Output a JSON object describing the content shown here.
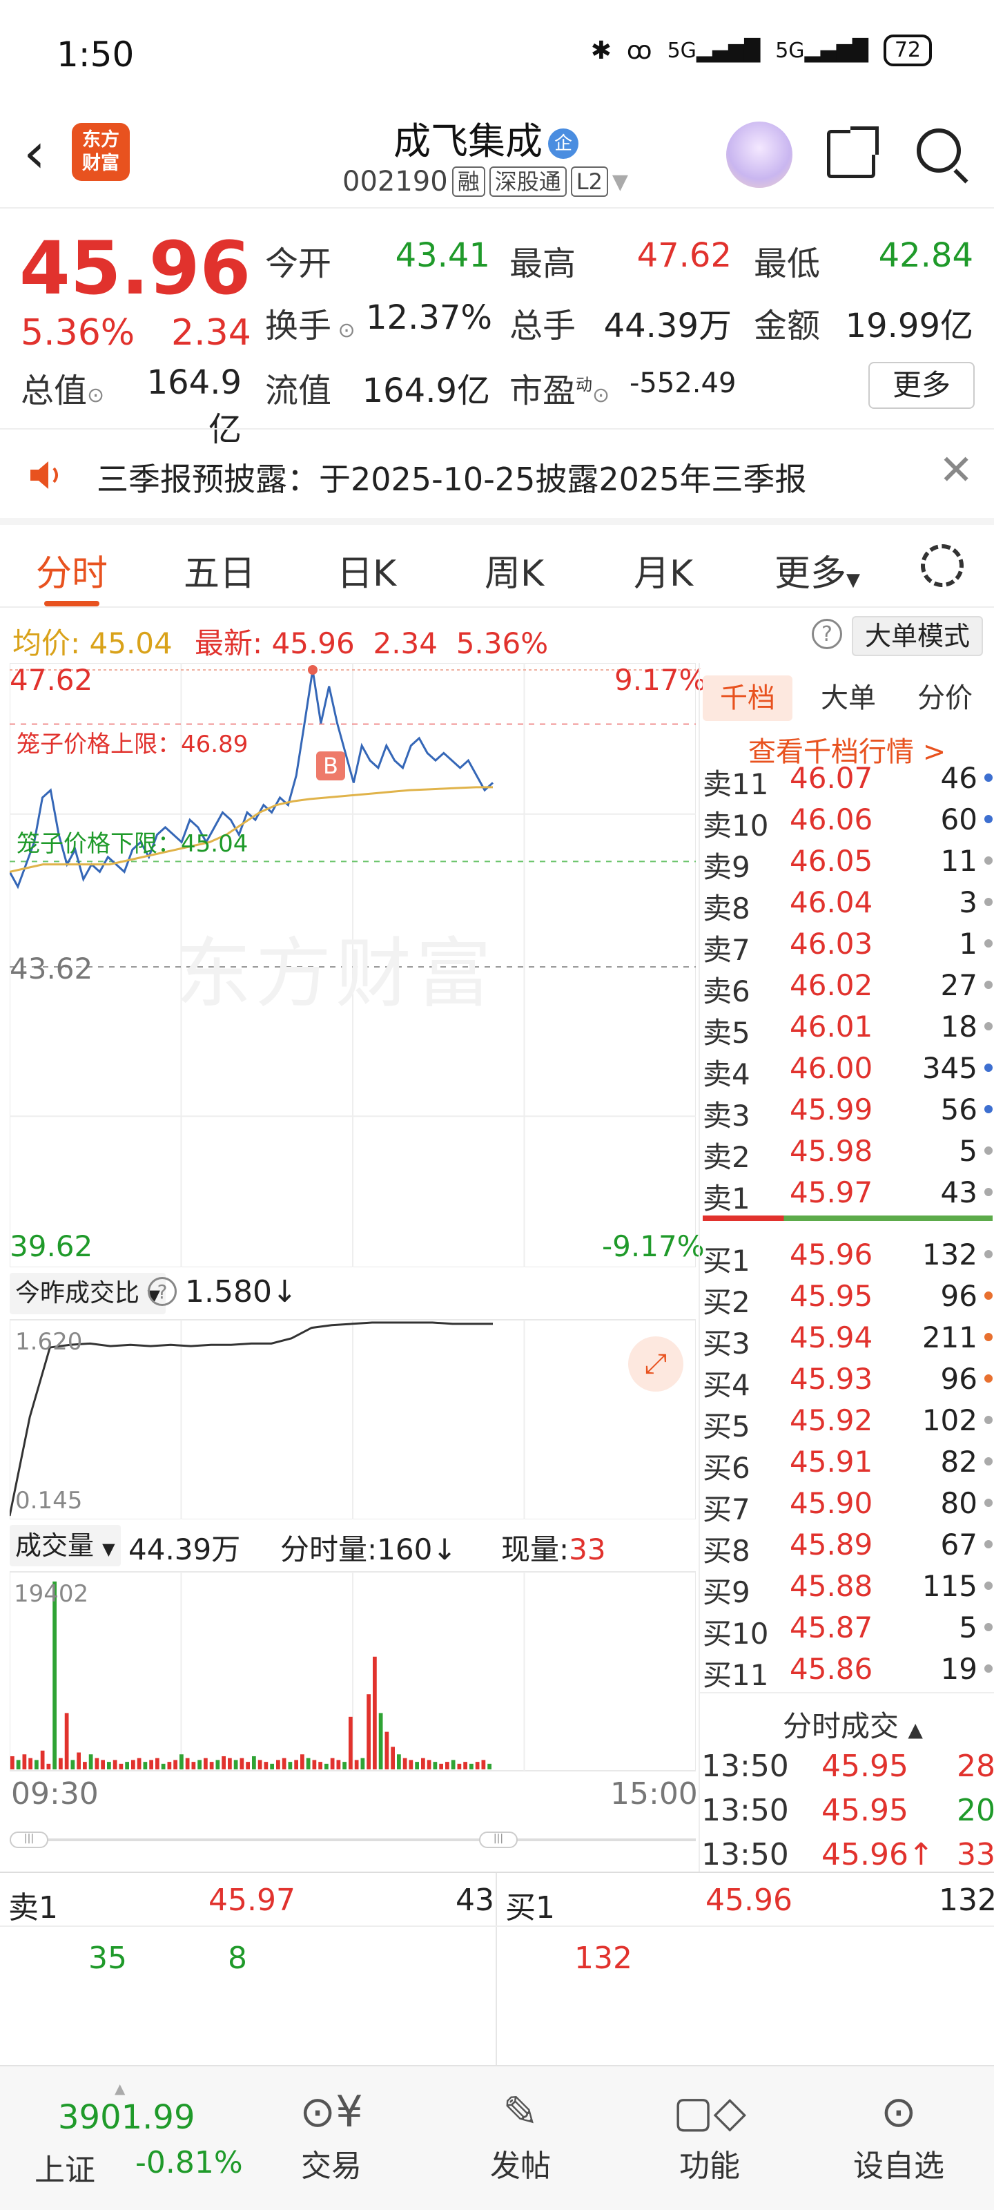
{
  "status_bar": {
    "time": "1:50",
    "icons": [
      "bluetooth-icon",
      "hd-icon",
      "5g-signal-icon",
      "5g-signal-icon"
    ],
    "battery": "72"
  },
  "header": {
    "logo_text": "东方财富",
    "stock_name": "成飞集成",
    "badge": "企",
    "code": "002190",
    "tags": [
      "融",
      "深股通",
      "L2"
    ]
  },
  "quote": {
    "price": "45.96",
    "change_pct": "5.36%",
    "change_amt": "2.34",
    "fields": [
      {
        "label": "今开",
        "value": "43.41",
        "color": "green"
      },
      {
        "label": "最高",
        "value": "47.62",
        "color": "red"
      },
      {
        "label": "最低",
        "value": "42.84",
        "color": "green"
      },
      {
        "label": "换手",
        "value": "12.37%",
        "color": "black"
      },
      {
        "label": "总手",
        "value": "44.39万",
        "color": "black"
      },
      {
        "label": "金额",
        "value": "19.99亿",
        "color": "black"
      },
      {
        "label": "总值",
        "value": "164.9亿",
        "color": "black"
      },
      {
        "label": "流值",
        "value": "164.9亿",
        "color": "black"
      },
      {
        "label": "市盈",
        "value": "-552.49",
        "color": "black"
      }
    ],
    "pe_superscript": "动",
    "more_label": "更多"
  },
  "notice": {
    "text": "三季报预披露：于2025-10-25披露2025年三季报"
  },
  "tabs": [
    "分时",
    "五日",
    "日K",
    "周K",
    "月K",
    "更多"
  ],
  "info_bar": {
    "avg_label": "均价:",
    "avg_value": "45.04",
    "latest_label": "最新:",
    "latest_value": "45.96",
    "change": "2.34",
    "change_pct": "5.36%",
    "mode_button": "大单模式"
  },
  "chart_main": {
    "y_top": "47.62",
    "y_bottom": "39.62",
    "pct_top": "9.17%",
    "pct_bottom": "-9.17%",
    "mid_label": "43.62",
    "upper_cage_label": "笼子价格上限：46.89",
    "lower_cage_label": "笼子价格下限：45.04",
    "watermark": "东方财富",
    "b_marker": "B"
  },
  "chart_ratio": {
    "label": "今昨成交比",
    "value": "1.580↓",
    "top": "1.620",
    "bottom": "0.145"
  },
  "chart_volume": {
    "label": "成交量",
    "total": "44.39万",
    "minute_label": "分时量:160↓",
    "current_label": "现量:",
    "current_value": "33",
    "top": "19402",
    "time_start": "09:30",
    "time_end": "15:00"
  },
  "chart_data": {
    "type": "line",
    "title": "",
    "xlabel": "",
    "ylabel": "",
    "x": [
      "09:30",
      "15:00"
    ],
    "ylim": [
      39.62,
      47.62
    ],
    "series": [],
    "price": [
      44.9,
      44.7,
      45.0,
      45.3,
      45.9,
      46.0,
      45.4,
      45.0,
      45.2,
      44.8,
      45.0,
      44.9,
      45.1,
      45.0,
      44.9,
      45.2,
      45.3,
      45.1,
      45.4,
      45.5,
      45.4,
      45.3,
      45.6,
      45.5,
      45.3,
      45.5,
      45.7,
      45.6,
      45.4,
      45.7,
      45.6,
      45.8,
      45.7,
      45.9,
      45.8,
      46.2,
      46.9,
      47.62,
      46.9,
      47.4,
      46.9,
      46.5,
      46.1,
      46.6,
      46.4,
      46.3,
      46.6,
      46.4,
      46.3,
      46.6,
      46.7,
      46.5,
      46.4,
      46.5,
      46.4,
      46.3,
      46.4,
      46.2,
      46.0,
      46.1
    ],
    "avg": [
      44.9,
      44.95,
      45.0,
      45.0,
      45.0,
      45.0,
      45.0,
      45.05,
      45.1,
      45.15,
      45.2,
      45.25,
      45.3,
      45.4,
      45.55,
      45.7,
      45.8,
      45.85,
      45.88,
      45.9,
      45.92,
      45.94,
      45.96,
      45.98,
      46.0,
      46.01,
      46.02,
      46.03,
      46.04,
      46.04
    ],
    "ratio": [
      0.145,
      0.9,
      1.43,
      1.45,
      1.46,
      1.44,
      1.45,
      1.44,
      1.45,
      1.44,
      1.45,
      1.45,
      1.46,
      1.46,
      1.5,
      1.58,
      1.6,
      1.61,
      1.62,
      1.62,
      1.62,
      1.62,
      1.61,
      1.61,
      1.61
    ],
    "volume_max": 19402,
    "volume": [
      7,
      5,
      8,
      6,
      5,
      10,
      3,
      100,
      6,
      30,
      5,
      9,
      4,
      8,
      6,
      5,
      4,
      5,
      3,
      4,
      5,
      6,
      4,
      5,
      6,
      3,
      4,
      5,
      8,
      6,
      4,
      5,
      6,
      4,
      5,
      7,
      6,
      5,
      6,
      4,
      7,
      5,
      4,
      3,
      5,
      6,
      4,
      5,
      8,
      6,
      5,
      4,
      3,
      6,
      5,
      4,
      28,
      5,
      6,
      40,
      60,
      30,
      20,
      12,
      8,
      6,
      5,
      4,
      6,
      5,
      4,
      3,
      4,
      5,
      3,
      4,
      3,
      4,
      5,
      3
    ]
  },
  "order_book": {
    "tabs": [
      "千档",
      "大单",
      "分价"
    ],
    "link": "查看千档行情 >",
    "sells": [
      {
        "label": "卖11",
        "price": "46.07",
        "vol": "46",
        "dot": "blue"
      },
      {
        "label": "卖10",
        "price": "46.06",
        "vol": "60",
        "dot": "blue"
      },
      {
        "label": "卖9",
        "price": "46.05",
        "vol": "11",
        "dot": "gray"
      },
      {
        "label": "卖8",
        "price": "46.04",
        "vol": "3",
        "dot": "gray"
      },
      {
        "label": "卖7",
        "price": "46.03",
        "vol": "1",
        "dot": "gray"
      },
      {
        "label": "卖6",
        "price": "46.02",
        "vol": "27",
        "dot": "gray"
      },
      {
        "label": "卖5",
        "price": "46.01",
        "vol": "18",
        "dot": "gray"
      },
      {
        "label": "卖4",
        "price": "46.00",
        "vol": "345",
        "dot": "blue"
      },
      {
        "label": "卖3",
        "price": "45.99",
        "vol": "56",
        "dot": "blue"
      },
      {
        "label": "卖2",
        "price": "45.98",
        "vol": "5",
        "dot": "gray"
      },
      {
        "label": "卖1",
        "price": "45.97",
        "vol": "43",
        "dot": "gray"
      }
    ],
    "buys": [
      {
        "label": "买1",
        "price": "45.96",
        "vol": "132",
        "dot": "gray"
      },
      {
        "label": "买2",
        "price": "45.95",
        "vol": "96",
        "dot": "orange"
      },
      {
        "label": "买3",
        "price": "45.94",
        "vol": "211",
        "dot": "orange"
      },
      {
        "label": "买4",
        "price": "45.93",
        "vol": "96",
        "dot": "orange"
      },
      {
        "label": "买5",
        "price": "45.92",
        "vol": "102",
        "dot": "gray"
      },
      {
        "label": "买6",
        "price": "45.91",
        "vol": "82",
        "dot": "gray"
      },
      {
        "label": "买7",
        "price": "45.90",
        "vol": "80",
        "dot": "gray"
      },
      {
        "label": "买8",
        "price": "45.89",
        "vol": "67",
        "dot": "gray"
      },
      {
        "label": "买9",
        "price": "45.88",
        "vol": "115",
        "dot": "gray"
      },
      {
        "label": "买10",
        "price": "45.87",
        "vol": "5",
        "dot": "gray"
      },
      {
        "label": "买11",
        "price": "45.86",
        "vol": "19",
        "dot": "gray"
      }
    ],
    "trade_header": "分时成交",
    "trades": [
      {
        "time": "13:50",
        "price": "45.95",
        "vol": "28",
        "vol_color": "red"
      },
      {
        "time": "13:50",
        "price": "45.95",
        "vol": "20",
        "vol_color": "green"
      },
      {
        "time": "13:50",
        "price": "45.96↑",
        "vol": "33",
        "vol_color": "red"
      }
    ]
  },
  "bottom_quote": {
    "sell_label": "卖1",
    "sell_price": "45.97",
    "sell_vol": "43",
    "buy_label": "买1",
    "buy_price": "45.96",
    "buy_vol": "132",
    "sell_sub1": "35",
    "sell_sub2": "8",
    "buy_sub1": "132"
  },
  "bottom_nav": {
    "index_value": "3901.99",
    "index_name": "上证",
    "index_change": "-0.81%",
    "items": [
      {
        "label": "交易",
        "icon": "yen-icon"
      },
      {
        "label": "发帖",
        "icon": "edit-icon"
      },
      {
        "label": "功能",
        "icon": "grid-icon"
      },
      {
        "label": "设自选",
        "icon": "more-icon"
      }
    ]
  },
  "colors": {
    "red": "#e1322d",
    "green": "#1f9a2a",
    "brand": "#e8521f",
    "avg_line": "#e0b34a",
    "price_line": "#3567b7"
  }
}
